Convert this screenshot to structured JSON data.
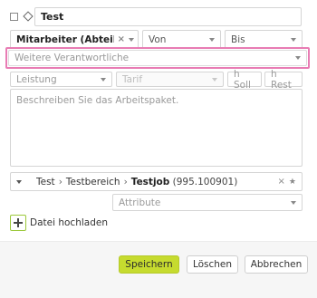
{
  "title": {
    "value": "Test"
  },
  "row2": {
    "employee": "Mitarbeiter (Abteilung",
    "von_placeholder": "Von",
    "bis_placeholder": "Bis"
  },
  "responsible": {
    "placeholder": "Weitere Verantwortliche"
  },
  "row4": {
    "leistung_placeholder": "Leistung",
    "tarif_placeholder": "Tarif",
    "hsoll_placeholder": "h Soll",
    "hrest_placeholder": "h Rest"
  },
  "description": {
    "placeholder": "Beschreiben Sie das Arbeitspaket."
  },
  "job": {
    "part1": "Test",
    "separator": "›",
    "part2": "Testbereich",
    "part3": "Testjob",
    "code": "(995.100901)",
    "clear": "×",
    "star": "★"
  },
  "attribute": {
    "placeholder": "Attribute"
  },
  "upload": {
    "label": "Datei hochladen"
  },
  "buttons": {
    "save": "Speichern",
    "delete": "Löschen",
    "cancel": "Abbrechen"
  },
  "colors": {
    "highlight": "#e87cb4",
    "primary": "#c6db2f",
    "upload_border": "#9bc83a"
  },
  "icons": {
    "clear": "×",
    "dropdown": "chevron-down-icon",
    "add": "plus-icon"
  }
}
